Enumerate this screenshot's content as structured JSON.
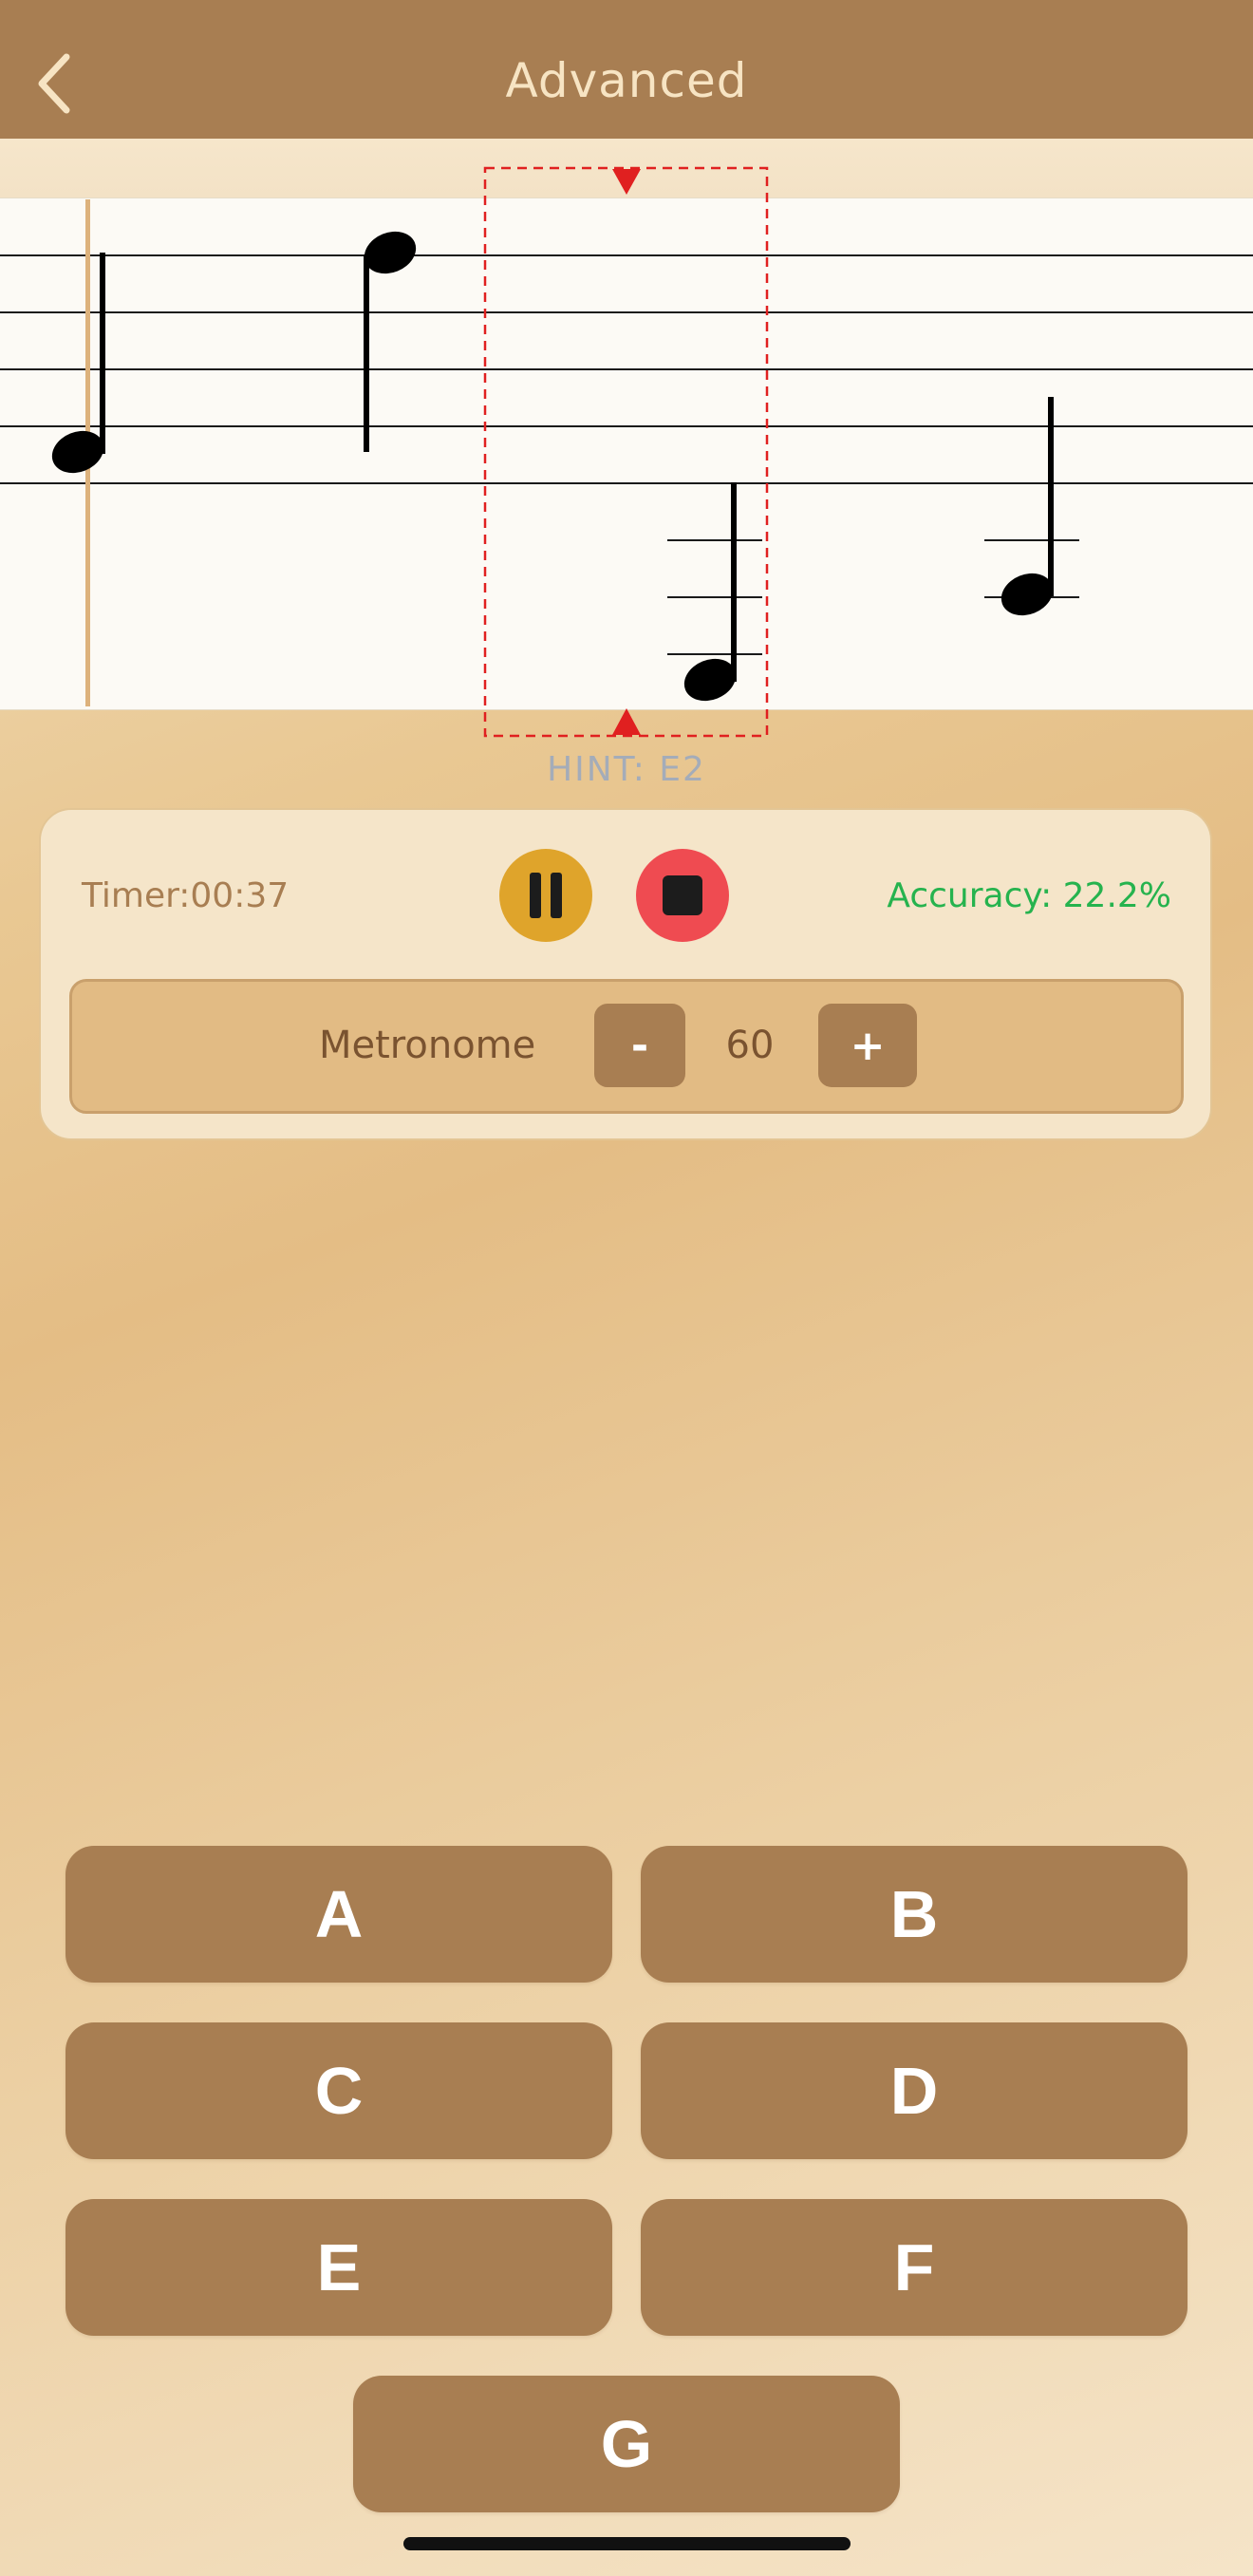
{
  "header": {
    "title": "Advanced",
    "back_icon": "chevron-left-icon"
  },
  "hint": {
    "text": "HINT: E2"
  },
  "controls": {
    "timer_text": "Timer:00:37",
    "pause_icon": "pause-icon",
    "stop_icon": "stop-icon",
    "accuracy_text": "Accuracy: 22.2%"
  },
  "metronome": {
    "label": "Metronome",
    "minus_label": "-",
    "bpm": "60",
    "plus_label": "+"
  },
  "answers": {
    "a": "A",
    "b": "B",
    "c": "C",
    "d": "D",
    "e": "E",
    "f": "F",
    "g": "G"
  },
  "colors": {
    "header_bg": "#a87e52",
    "title_text": "#f7e4c3",
    "accuracy": "#26b34e",
    "pause_button": "#dfa42b",
    "stop_button": "#ef4b51",
    "answer_button": "#a87e52",
    "target_box": "#e02020"
  }
}
